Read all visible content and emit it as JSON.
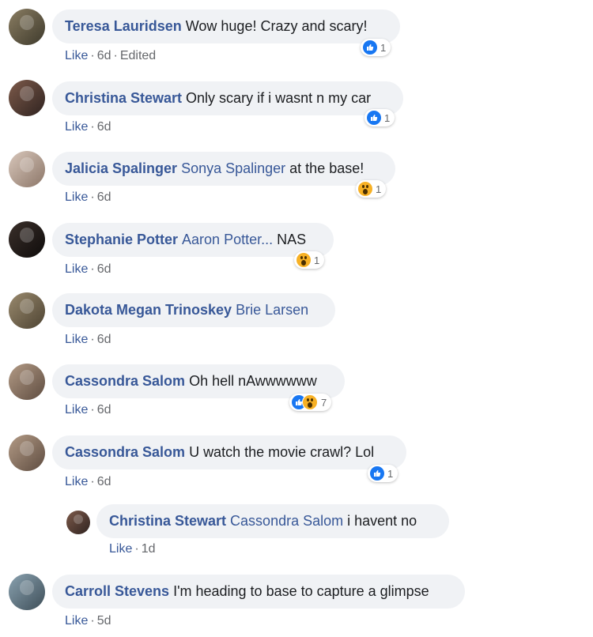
{
  "comments": [
    {
      "author": "Teresa Lauridsen",
      "mention": "",
      "text": "Wow huge! Crazy and scary!",
      "like": "Like",
      "time": "6d",
      "edited": "Edited",
      "reactions": [
        "like-icon"
      ],
      "reaction_count": "1"
    },
    {
      "author": "Christina Stewart",
      "mention": "",
      "text": "Only scary if i wasnt n my car",
      "like": "Like",
      "time": "6d",
      "reactions": [
        "like-icon"
      ],
      "reaction_count": "1"
    },
    {
      "author": "Jalicia Spalinger",
      "mention": "Sonya Spalinger",
      "text": "at the base!",
      "like": "Like",
      "time": "6d",
      "reactions": [
        "wow-icon"
      ],
      "reaction_count": "1"
    },
    {
      "author": "Stephanie Potter",
      "mention": "Aaron Potter...",
      "text": "NAS",
      "like": "Like",
      "time": "6d",
      "reactions": [
        "wow-icon"
      ],
      "reaction_count": "1"
    },
    {
      "author": "Dakota Megan Trinoskey",
      "mention": "Brie Larsen",
      "text": "",
      "like": "Like",
      "time": "6d"
    },
    {
      "author": "Cassondra Salom",
      "mention": "",
      "text": "Oh hell nAwwwwww",
      "like": "Like",
      "time": "6d",
      "reactions": [
        "like-icon",
        "wow-icon"
      ],
      "reaction_count": "7"
    },
    {
      "author": "Cassondra Salom",
      "mention": "",
      "text": "U watch the movie crawl? Lol",
      "like": "Like",
      "time": "6d",
      "reactions": [
        "like-icon"
      ],
      "reaction_count": "1"
    },
    {
      "author": "Christina Stewart",
      "mention": "Cassondra Salom",
      "text": "i havent no",
      "like": "Like",
      "time": "1d",
      "is_reply": true
    },
    {
      "author": "Carroll Stevens",
      "mention": "",
      "text": "I'm heading to base to capture a glimpse",
      "like": "Like",
      "time": "5d"
    }
  ],
  "meta_separator": "·",
  "colors": {
    "author_link": "#385898",
    "bubble_bg": "#f0f2f5",
    "meta_text": "#65676b",
    "like_blue": "#1877f2",
    "wow_yellow": "#f7b125"
  }
}
